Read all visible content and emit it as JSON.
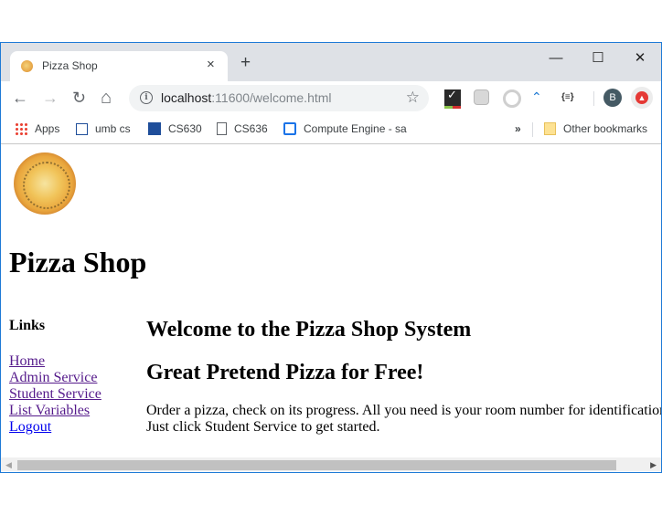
{
  "browser": {
    "tab_title": "Pizza Shop",
    "tab_close": "×",
    "new_tab": "+",
    "window_controls": {
      "minimize": "—",
      "maximize": "☐",
      "close": "✕"
    },
    "nav": {
      "back": "←",
      "forward": "→",
      "reload": "↻",
      "home": "⌂"
    },
    "url_host": "localhost",
    "url_rest": ":11600/welcome.html",
    "info_glyph": "i",
    "star_glyph": "☆",
    "profile_initial": "B",
    "extensions": [
      "checkmark-extension-icon",
      "cube-extension-icon",
      "hexagon-extension-icon",
      "chevron-extension-icon",
      "json-viewer-extension-icon"
    ],
    "json_ext_label": "{≡}",
    "bookmarks": [
      {
        "label": "Apps",
        "icon": "apps-grid-icon"
      },
      {
        "label": "umb cs",
        "icon": "umb-logo-icon"
      },
      {
        "label": "CS630",
        "icon": "umb-logo-icon"
      },
      {
        "label": "CS636",
        "icon": "page-icon"
      },
      {
        "label": "Compute Engine - sa",
        "icon": "compute-engine-icon"
      }
    ],
    "overflow": "»",
    "other_bookmarks": "Other bookmarks"
  },
  "page": {
    "site_title": "Pizza Shop",
    "links_heading": "Links",
    "links": [
      {
        "label": "Home",
        "visited": true
      },
      {
        "label": "Admin Service",
        "visited": true
      },
      {
        "label": "Student Service",
        "visited": true
      },
      {
        "label": "List Variables",
        "visited": true
      },
      {
        "label": "Logout",
        "visited": false
      }
    ],
    "welcome_heading": "Welcome to the Pizza Shop System",
    "tagline_heading": "Great Pretend Pizza for Free!",
    "body_line1": "Order a pizza, check on its progress. All you need is your room number for identification.",
    "body_line2": "Just click Student Service to get started."
  },
  "scrollbar": {
    "left_arrow": "◀",
    "right_arrow": "▶"
  }
}
